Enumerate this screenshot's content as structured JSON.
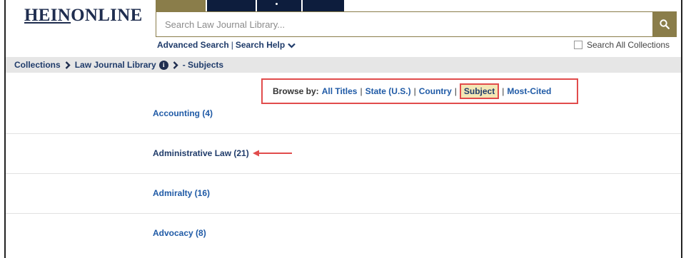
{
  "header": {
    "logo": {
      "part1": "HEIN",
      "part2": "ONLINE"
    },
    "search": {
      "placeholder": "Search Law Journal Library..."
    },
    "advanced_search": "Advanced Search",
    "separator": "|",
    "search_help": "Search Help",
    "search_all_collections": "Search All Collections"
  },
  "breadcrumb": {
    "collections": "Collections",
    "library": "Law Journal Library",
    "info": "i",
    "current": "- Subjects"
  },
  "browse_by": {
    "label": "Browse by:",
    "items": [
      {
        "label": "All Titles"
      },
      {
        "label": "State (U.S.)"
      },
      {
        "label": "Country"
      },
      {
        "label": "Subject",
        "active": true
      },
      {
        "label": "Most-Cited"
      }
    ],
    "separator": "|"
  },
  "subjects": [
    {
      "label": "Accounting (4)"
    },
    {
      "label": "Administrative Law (21)"
    },
    {
      "label": "Admiralty (16)"
    },
    {
      "label": "Advocacy (8)"
    }
  ],
  "colors": {
    "brand_navy": "#0d1d3d",
    "brand_gold": "#8a7d4a",
    "link_blue": "#1f5aa6",
    "highlight_red": "#e14c4c",
    "active_bg": "#f3e7b5"
  }
}
